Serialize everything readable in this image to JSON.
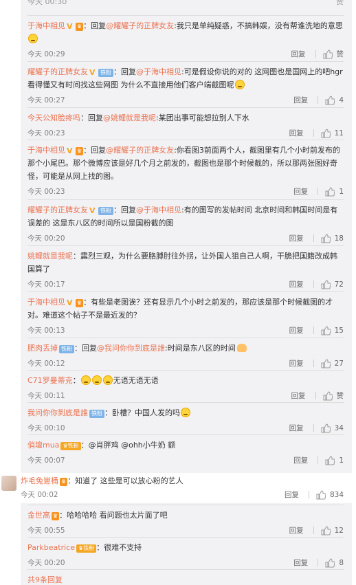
{
  "cutoff": {
    "time": "今天 00:30",
    "like_label": "赞"
  },
  "replies": [
    {
      "user": "于海中相见",
      "badges": [
        "v",
        "crown"
      ],
      "prefix": "：回复",
      "mention": "@耀耀子的正牌女友",
      "text": ":我只是单纯疑惑，不搞韩娱，没有帮谁洗地的意思",
      "emoji": true,
      "time": "今天 00:29",
      "reply_label": "回复",
      "likes": "赞"
    },
    {
      "user": "耀耀子的正牌女友",
      "badges": [
        "v",
        "fan"
      ],
      "prefix": "：回复",
      "mention": "@于海中相见",
      "text": ":可是假设你说的对的 这网图也是国网上的吧hgr看得懂又有时间找这些网图 为什么不直接用他们客户端截图呢",
      "emoji": true,
      "time": "今天 00:27",
      "reply_label": "回复",
      "likes": "4"
    },
    {
      "user": "今天公知脸疼吗",
      "badges": [],
      "prefix": "：回复",
      "mention": "@姚鲤就是我呢",
      "text": ":某团出事可能想拉别人下水",
      "emoji": false,
      "time": "今天 00:23",
      "reply_label": "回复",
      "likes": "11"
    },
    {
      "user": "于海中相见",
      "badges": [
        "v",
        "crown"
      ],
      "prefix": "：回复",
      "mention": "@耀耀子的正牌女友",
      "text": ":你看图3前面两个人，截图里有几个小时前发布的那个小尾巴。那个微博应该是好几个月之前发的，截图也是那个时候截的，所以那两张图好奇怪，可能是从网上找的图。",
      "emoji": false,
      "time": "今天 00:23",
      "reply_label": "回复",
      "likes": "1"
    },
    {
      "user": "耀耀子的正牌女友",
      "badges": [
        "v",
        "fan"
      ],
      "prefix": "：回复",
      "mention": "@于海中相见",
      "text": ":有的图写的发帖时间 北京时间和韩国时间是有误差的 这是东八区的时间所以是国粉截的图",
      "emoji": false,
      "time": "今天 00:20",
      "reply_label": "回复",
      "likes": "18"
    },
    {
      "user": "姚鲤就是我呢",
      "badges": [],
      "prefix": "",
      "mention": "",
      "text": "：震烈三观，为什么要胳膊肘往外拐，让外国人狙自己人啊，干脆把国籍改成韩国算了",
      "emoji": false,
      "time": "今天 00:17",
      "reply_label": "回复",
      "likes": "72"
    },
    {
      "user": "于海中相见",
      "badges": [
        "v",
        "crown"
      ],
      "prefix": "",
      "mention": "",
      "text": "：有些是老图诶？还有显示几个小时之前发的，那应该是那个时候截图的才对。难道这个帖子不是最近发的？",
      "emoji": false,
      "time": "今天 00:13",
      "reply_label": "回复",
      "likes": "15"
    },
    {
      "user": "肥肉丢掉",
      "badges": [
        "fan"
      ],
      "prefix": "：回复",
      "mention": "@我问你你到底是誰",
      "text": ":时间是东八区的时间",
      "emoji": "hand",
      "time": "今天 00:12",
      "reply_label": "回复",
      "likes": "27"
    },
    {
      "user": "C71罗曼蒂克",
      "badges": [],
      "prefix": "：",
      "mention": "",
      "text": "无语无语无语",
      "emoji": "triple",
      "time": "今天 00:11",
      "reply_label": "回复",
      "likes": "赞"
    },
    {
      "user": "我问你你到底是誰",
      "badges": [
        "fan"
      ],
      "prefix": "",
      "mention": "",
      "text": "：卧槽？中国人发的吗",
      "emoji": true,
      "time": "今天 00:10",
      "reply_label": "回复",
      "likes": "34"
    },
    {
      "user": "俏壇mua",
      "badges": [
        "crownfan"
      ],
      "prefix": "",
      "mention": "",
      "text": "：@肖胖鸡 @ohh小牛奶 额",
      "emoji": false,
      "time": "今天 00:07",
      "reply_label": "回复",
      "likes": "1"
    }
  ],
  "main_comment": {
    "user": "炸毛兔崽桶",
    "text": "：知道了 这些是可以放心粉的艺人",
    "time": "今天 00:02",
    "reply_label": "回复",
    "likes": "834"
  },
  "sub_replies": [
    {
      "user": "金世高",
      "badges": [
        "crown"
      ],
      "text": "：哈哈哈哈 看问题也太片面了吧",
      "time": "今天 00:55",
      "reply_label": "回复",
      "likes": "12"
    },
    {
      "user": "Parkbeatrice",
      "badges": [
        "crownfan"
      ],
      "text": "：很难不支持",
      "time": "今天 00:20",
      "reply_label": "回复",
      "likes": "8"
    }
  ],
  "more_link": "共9条回复",
  "badge_labels": {
    "v": "V",
    "crown": "♛",
    "fan": "铁粉",
    "crownfan": "♛铁粉"
  },
  "colors": {
    "accent": "#eb7350",
    "meta": "#808080",
    "panel": "#f2f2f5"
  }
}
